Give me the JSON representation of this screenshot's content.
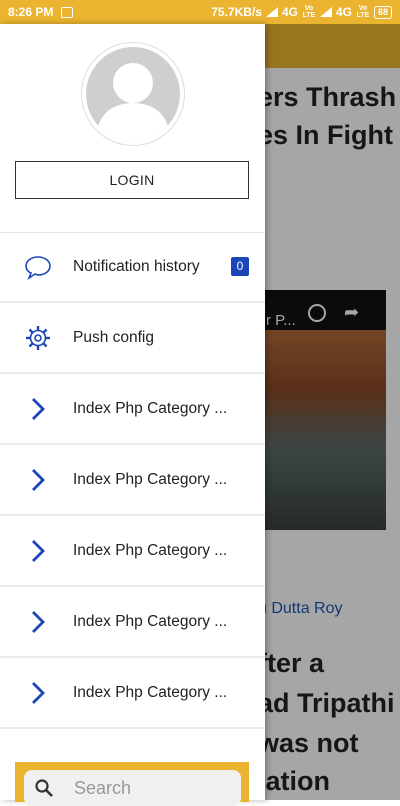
{
  "status_bar": {
    "time": "8:26 PM",
    "speed": "75.7KB/s",
    "network1": "4G",
    "network2": "4G",
    "volte1": "Vo LTE",
    "volte2": "Vo LTE",
    "battery": "68"
  },
  "background": {
    "headline1_line1": "ers Thrash",
    "headline1_line2": "es In Fight",
    "video_title": "r P...",
    "author": "u Dutta Roy",
    "headline2_line1": "fter a",
    "headline2_line2": "ad Tripathi",
    "headline2_line3": "was not",
    "headline2_line4": "lation"
  },
  "drawer": {
    "login_label": "LOGIN",
    "items": [
      {
        "label": "Notification history",
        "icon": "chat-bubble-icon",
        "badge": "0"
      },
      {
        "label": "Push config",
        "icon": "gear-icon"
      },
      {
        "label": "Index Php Category ...",
        "icon": "chevron-right-icon"
      },
      {
        "label": "Index Php Category ...",
        "icon": "chevron-right-icon"
      },
      {
        "label": "Index Php Category ...",
        "icon": "chevron-right-icon"
      },
      {
        "label": "Index Php Category ...",
        "icon": "chevron-right-icon"
      },
      {
        "label": "Index Php Category ...",
        "icon": "chevron-right-icon"
      }
    ],
    "search_placeholder": "Search"
  },
  "colors": {
    "accent": "#eab430",
    "icon_blue": "#1a46b8"
  }
}
